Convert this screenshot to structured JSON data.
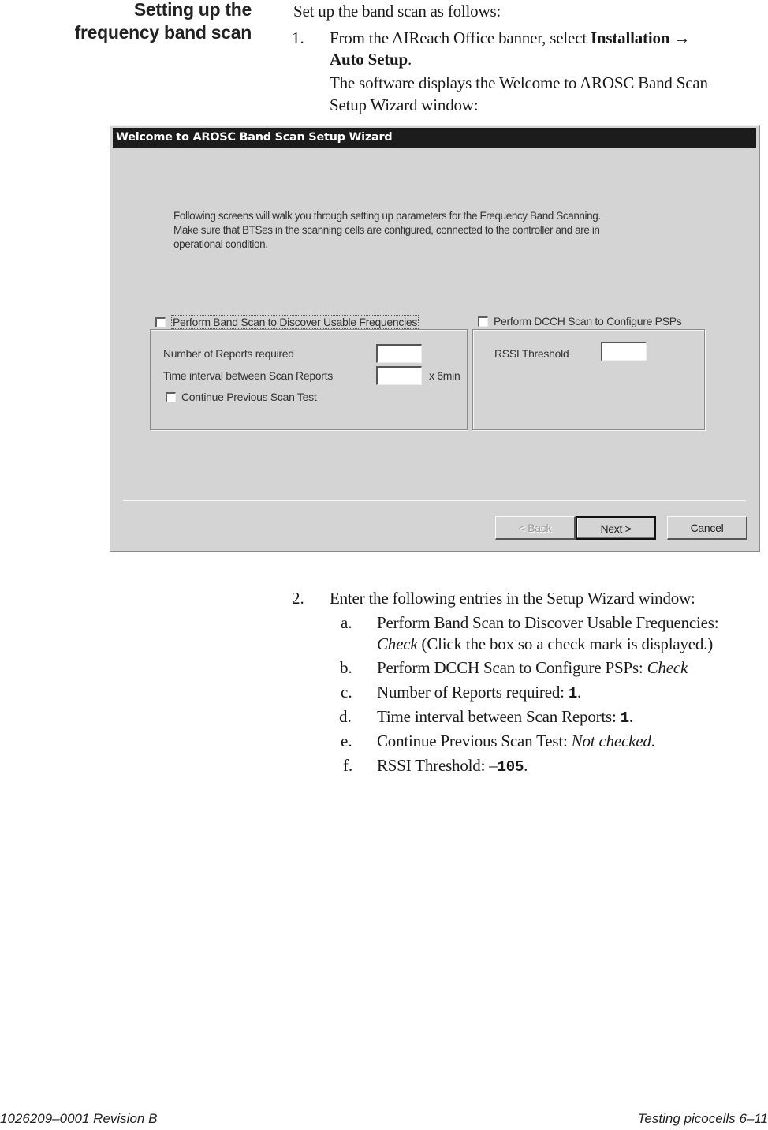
{
  "side_heading": [
    "Setting up the",
    "frequency band scan"
  ],
  "intro_text": "Set up the band scan as follows:",
  "steps": [
    {
      "number": "1.",
      "line1_prefix": "From the AIReach Office banner, select ",
      "line1_bold": "Installation →",
      "line2_bold": "Auto Setup",
      "line2_suffix": ".",
      "result_line1": "The software displays the Welcome to AROSC Band Scan",
      "result_line2": "Setup Wizard window:"
    },
    {
      "number": "2.",
      "text": "Enter the following entries in the Setup Wizard window:",
      "substeps": [
        {
          "letter": "a.",
          "label": "Perform Band Scan to Discover Usable Frequencies:",
          "value": "Check",
          "note": " (Click the box so a check mark is displayed.)"
        },
        {
          "letter": "b.",
          "label": "Perform DCCH Scan to Configure PSPs: ",
          "value": "Check"
        },
        {
          "letter": "c.",
          "label": "Number of Reports required: ",
          "value": "1",
          "suffix": "."
        },
        {
          "letter": "d.",
          "label": "Time interval between Scan Reports: ",
          "value": "1",
          "suffix": "."
        },
        {
          "letter": "e.",
          "label": "Continue Previous Scan Test: ",
          "value": "Not checked",
          "suffix": "."
        },
        {
          "letter": "f.",
          "label": "RSSI Threshold:  –",
          "value": "105",
          "suffix": "."
        }
      ]
    }
  ],
  "dialog": {
    "title": "Welcome to AROSC Band Scan Setup Wizard",
    "intro_lines": [
      "Following screens will walk you through setting up parameters for the Frequency Band Scanning.",
      "Make sure that BTSes in the scanning cells are configured, connected to the controller and are in",
      "operational condition."
    ],
    "band_scan": {
      "checkbox_label": "Perform Band Scan to Discover Usable Frequencies",
      "checked": false,
      "reports_label": "Number of Reports required",
      "reports_value": "",
      "interval_label": "Time interval between Scan Reports",
      "interval_value": "",
      "interval_unit": "x 6min",
      "continue_label": "Continue Previous Scan Test",
      "continue_checked": false
    },
    "dcch_scan": {
      "checkbox_label": "Perform DCCH Scan to Configure PSPs",
      "checked": false,
      "rssi_label": "RSSI Threshold",
      "rssi_value": ""
    },
    "buttons": {
      "back": "< Back",
      "next": "Next >",
      "cancel": "Cancel"
    }
  },
  "footer": {
    "left": "1026209–0001  Revision B",
    "right": "Testing picocells   6–11"
  }
}
